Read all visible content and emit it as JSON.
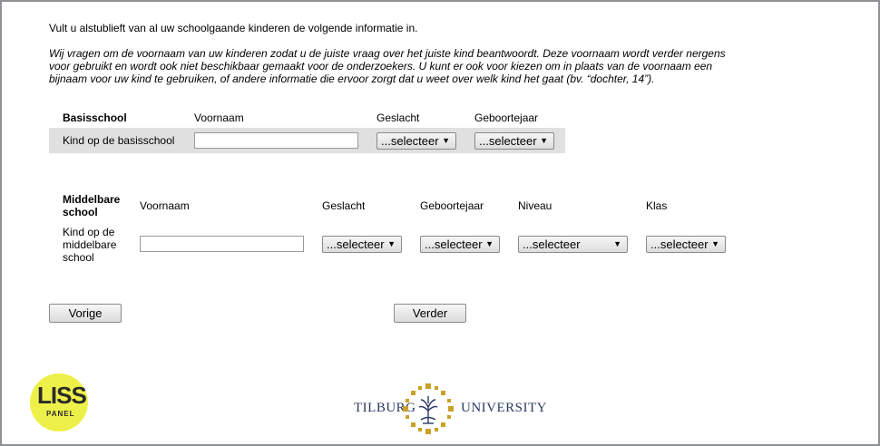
{
  "intro": "Vult u alstublieft van al uw schoolgaande kinderen de volgende informatie in.",
  "note": "Wij vragen om de voornaam van uw kinderen zodat u de juiste vraag over het juiste kind beantwoordt. Deze voornaam wordt verder nergens voor gebruikt en wordt ook niet beschikbaar gemaakt voor de onderzoekers. U kunt er ook voor kiezen om in plaats van de voornaam een bijnaam voor uw kind te gebruiken, of andere informatie die ervoor zorgt dat u weet over welk kind het gaat (bv. “dochter, 14”).",
  "basisschool": {
    "header": "Basisschool",
    "col_voornaam": "Voornaam",
    "col_geslacht": "Geslacht",
    "col_geboortejaar": "Geboortejaar",
    "row_label": "Kind op de basisschool",
    "voornaam_value": "",
    "geslacht_value": "...selecteer",
    "geboortejaar_value": "...selecteer"
  },
  "middelbare": {
    "header_line1": "Middelbare",
    "header_line2": "school",
    "col_voornaam": "Voornaam",
    "col_geslacht": "Geslacht",
    "col_geboortejaar": "Geboortejaar",
    "col_niveau": "Niveau",
    "col_klas": "Klas",
    "row_label_line1": "Kind op de",
    "row_label_line2": "middelbare",
    "row_label_line3": "school",
    "voornaam_value": "",
    "geslacht_value": "...selecteer",
    "geboortejaar_value": "...selecteer",
    "niveau_value": "...selecteer",
    "klas_value": "...selecteer"
  },
  "buttons": {
    "prev": "Vorige",
    "next": "Verder"
  },
  "logos": {
    "liss_main": "LISS",
    "liss_sub": "PANEL",
    "tilburg": "TILBURG",
    "university": "UNIVERSITY",
    "liss_color": "#eef04a",
    "tilburg_color": "#2b3a63",
    "seal_color": "#c9a227"
  },
  "icons": {
    "dropdown": "chevron-down-icon"
  }
}
